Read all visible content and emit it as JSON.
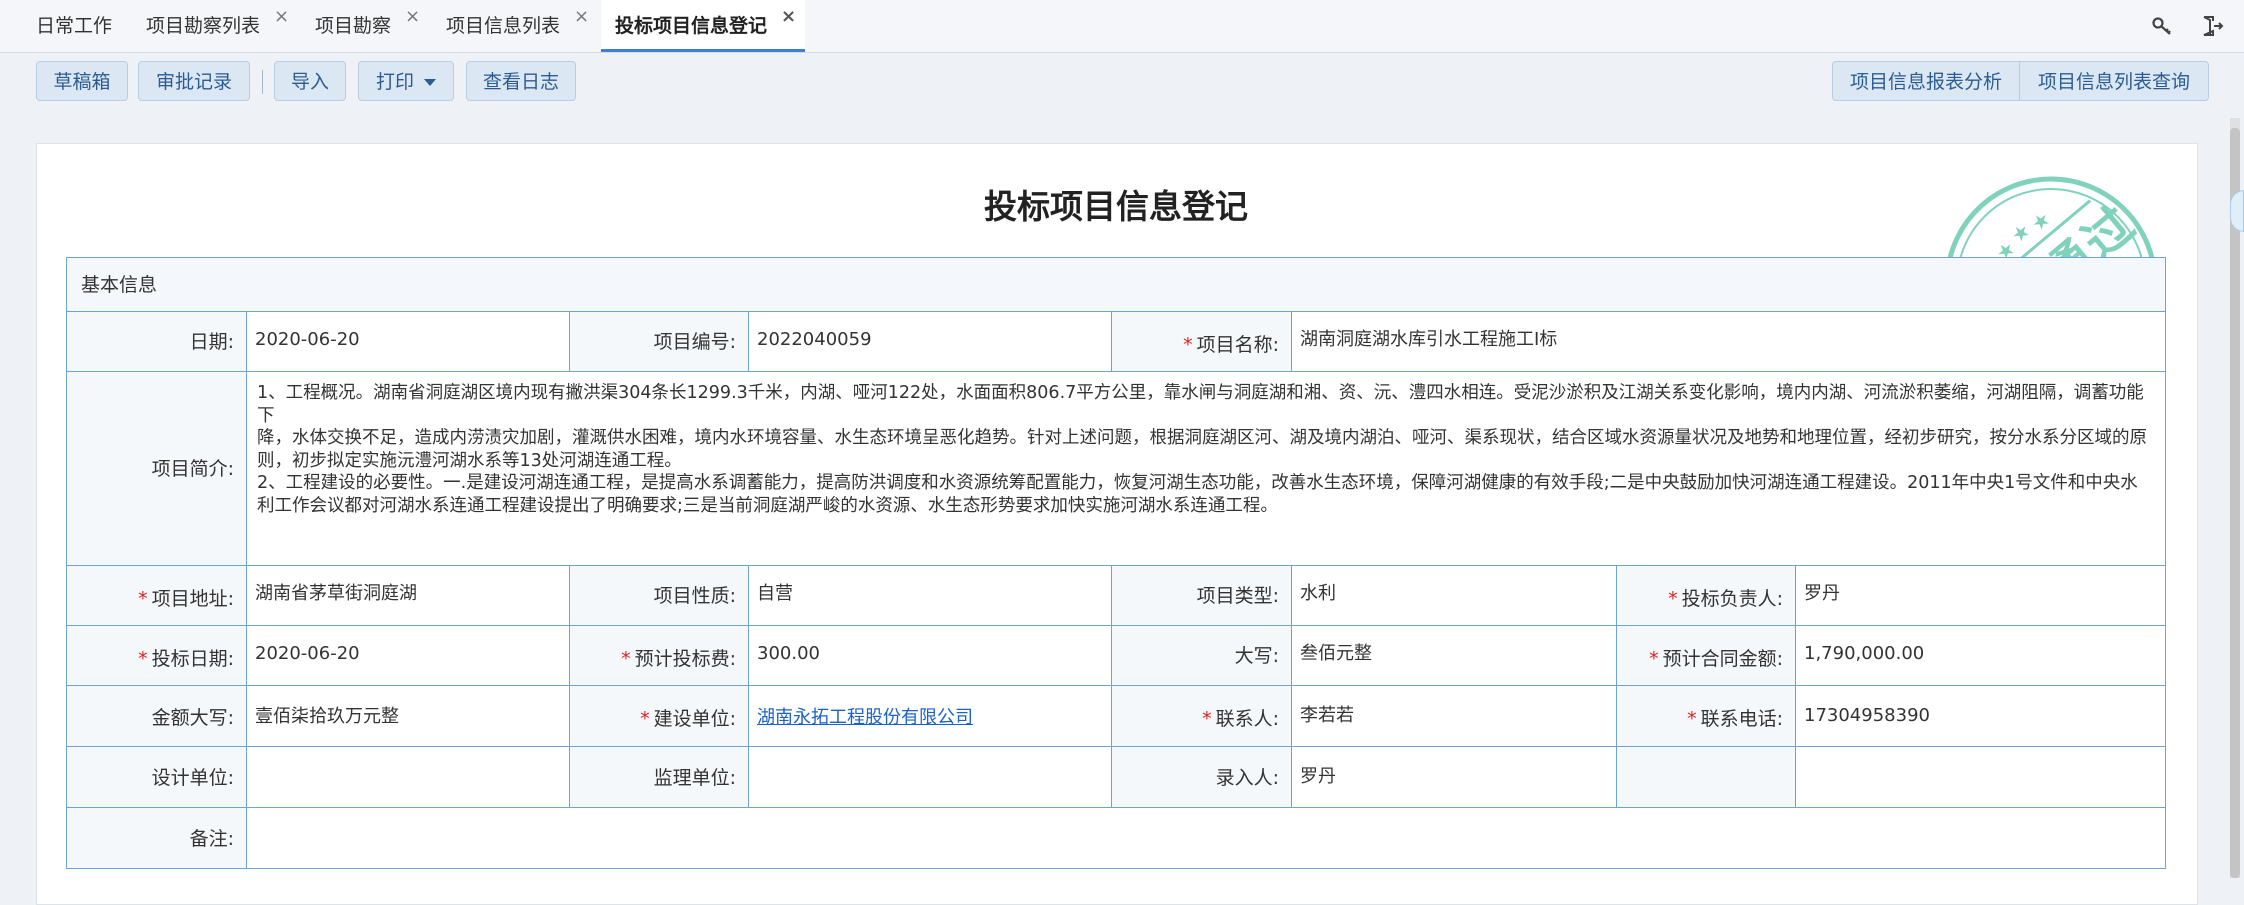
{
  "tabs": [
    {
      "label": "日常工作",
      "close": false
    },
    {
      "label": "项目勘察列表",
      "close": true
    },
    {
      "label": "项目勘察",
      "close": true
    },
    {
      "label": "项目信息列表",
      "close": true
    },
    {
      "label": "投标项目信息登记",
      "close": true,
      "active": true
    }
  ],
  "close_glyph": "×",
  "toolbar": {
    "drafts": "草稿箱",
    "approval_log": "审批记录",
    "import": "导入",
    "print": "打印",
    "view_log": "查看日志",
    "report_analysis": "项目信息报表分析",
    "list_query": "项目信息列表查询"
  },
  "form": {
    "title": "投标项目信息登记",
    "section": "基本信息",
    "required_mark": "*",
    "labels": {
      "date": "日期:",
      "project_no": "项目编号:",
      "project_name": "项目名称:",
      "intro": "项目简介:",
      "address": "项目地址:",
      "nature": "项目性质:",
      "type": "项目类型:",
      "bid_leader": "投标负责人:",
      "bid_date": "投标日期:",
      "est_fee": "预计投标费:",
      "capital": "大写:",
      "est_contract": "预计合同金额:",
      "amount_capital": "金额大写:",
      "builder": "建设单位:",
      "contact": "联系人:",
      "phone": "联系电话:",
      "design": "设计单位:",
      "supervise": "监理单位:",
      "entry": "录入人:",
      "remark": "备注:"
    },
    "values": {
      "date": "2020-06-20",
      "project_no": "2022040059",
      "project_name": "湖南洞庭湖水库引水工程施工I标",
      "intro": "1、工程概况。湖南省洞庭湖区境内现有撇洪渠304条长1299.3千米，内湖、哑河122处，水面面积806.7平方公里，靠水闸与洞庭湖和湘、资、沅、澧四水相连。受泥沙淤积及江湖关系变化影响，境内内湖、河流淤积萎缩，河湖阻隔，调蓄功能下\n降，水体交换不足，造成内涝渍灾加剧，灌溉供水困难，境内水环境容量、水生态环境呈恶化趋势。针对上述问题，根据洞庭湖区河、湖及境内湖泊、哑河、渠系现状，结合区域水资源量状况及地势和地理位置，经初步研究，按分水系分区域的原则，初步拟定实施沅澧河湖水系等13处河湖连通工程。\n2、工程建设的必要性。一.是建设河湖连通工程，是提高水系调蓄能力，提高防洪调度和水资源统筹配置能力，恢复河湖生态功能，改善水生态环境，保障河湖健康的有效手段;二是中央鼓励加快河湖连通工程建设。2011年中央1号文件和中央水利工作会议都对河湖水系连通工程建设提出了明确要求;三是当前洞庭湖严峻的水资源、水生态形势要求加快实施河湖水系连通工程。",
      "address": "湖南省茅草街洞庭湖",
      "nature": "自营",
      "type": "水利",
      "bid_leader": "罗丹",
      "bid_date": "2020-06-20",
      "est_fee": "300.00",
      "capital": "叁佰元整",
      "est_contract": "1,790,000.00",
      "amount_capital": "壹佰柒拾玖万元整",
      "builder": "湖南永拓工程股份有限公司",
      "contact": "李若若",
      "phone": "17304958390",
      "design": "",
      "supervise": "",
      "entry": "罗丹",
      "remark": ""
    }
  },
  "stamp": {
    "text": "审核通过"
  },
  "colors": {
    "accent": "#3b7fd9",
    "border": "#6fa3d6",
    "stamp": "#57c3a6",
    "required": "#e02020"
  },
  "icons": [
    "key-icon",
    "logout-icon",
    "close-icon",
    "caret-down-icon",
    "star-icon"
  ]
}
